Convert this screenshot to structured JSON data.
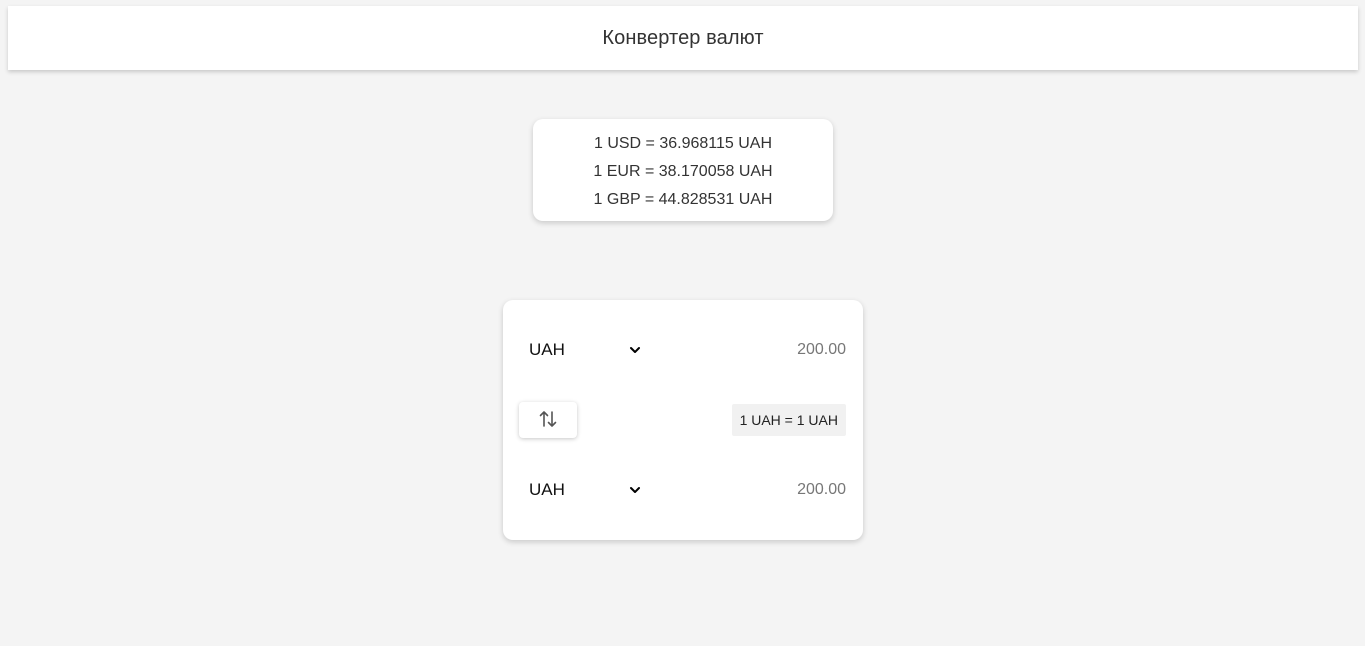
{
  "header": {
    "title": "Конвертер валют"
  },
  "rates": [
    "1 USD = 36.968115 UAH",
    "1 EUR = 38.170058 UAH",
    "1 GBP = 44.828531 UAH"
  ],
  "converter": {
    "from": {
      "currency": "UAH",
      "amount": "200.00"
    },
    "to": {
      "currency": "UAH",
      "amount": "200.00"
    },
    "rate_text": "1 UAH = 1 UAH",
    "swap_icon": "swap-vertical-icon"
  }
}
